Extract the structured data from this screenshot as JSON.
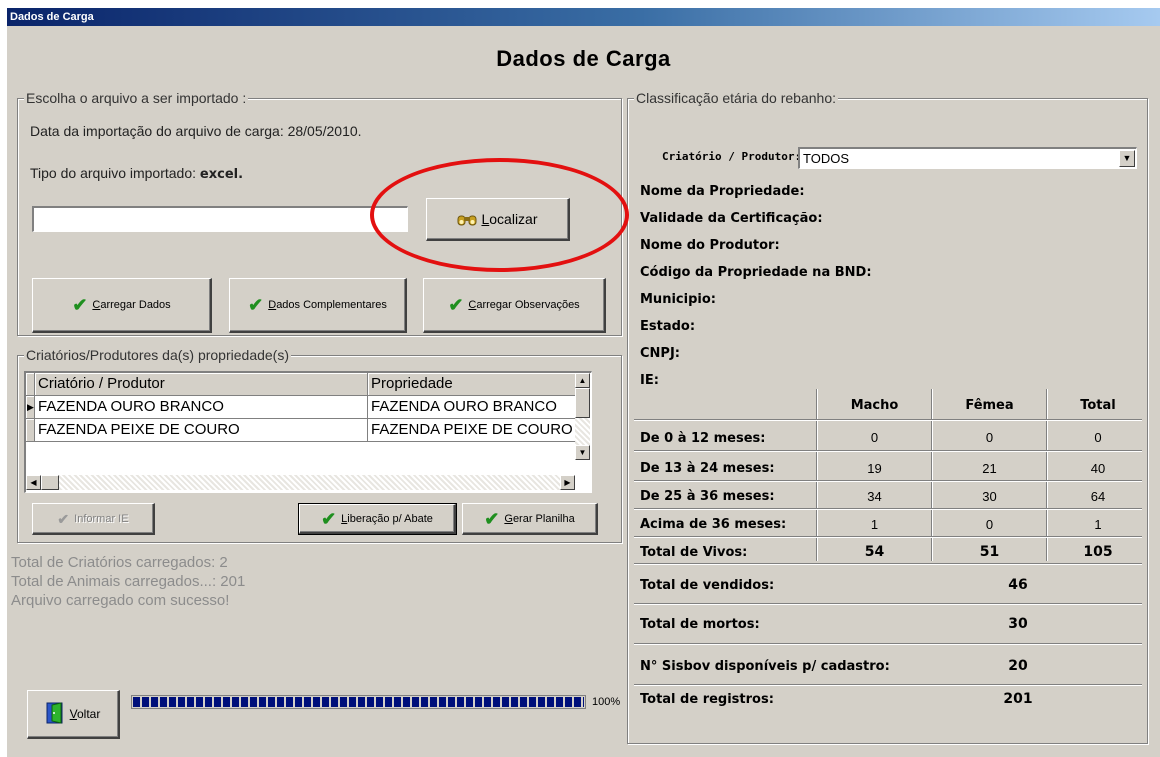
{
  "window": {
    "title": "Dados de Carga"
  },
  "heading": "Dados de Carga",
  "import_group": {
    "legend": "Escolha o arquivo a ser importado :",
    "date_line": "Data da importação do arquivo de carga: 28/05/2010.",
    "type_label": "Tipo do arquivo importado:",
    "type_value": "excel.",
    "file_path_value": "",
    "locate_button": {
      "label_u": "L",
      "label_rest": "ocalizar",
      "icon": "binoculars-icon"
    },
    "buttons": [
      {
        "label_u": "C",
        "label_rest": "arregar Dados",
        "icon": "check-icon"
      },
      {
        "label_u": "D",
        "label_rest": "ados Complementares",
        "icon": "check-icon"
      },
      {
        "label_u": "C",
        "label_rest": "arregar Observações",
        "icon": "check-icon"
      }
    ]
  },
  "producers_group": {
    "legend": "Criatórios/Produtores da(s) propriedade(s)",
    "columns": [
      "Criatório / Produtor",
      "Propriedade"
    ],
    "rows": [
      {
        "produtor": "FAZENDA OURO BRANCO",
        "propriedade": "FAZENDA OURO BRANCO",
        "current": true
      },
      {
        "produtor": "FAZENDA PEIXE DE COURO",
        "propriedade": "FAZENDA PEIXE DE COURO",
        "current": false
      }
    ],
    "buttons": {
      "informar_ie": "Informar IE",
      "liberacao": {
        "label_u": "L",
        "label_rest": "iberação p/ Abate"
      },
      "gerar": {
        "label_u": "G",
        "label_rest": "erar Planilha"
      }
    }
  },
  "status": {
    "line1": "Total de Criatórios carregados: 2",
    "line2": "Total de Animais carregados...: 201",
    "line3": "Arquivo carregado com sucesso!"
  },
  "footer": {
    "voltar": {
      "label_u": "V",
      "label_rest": "oltar",
      "icon": "exit-door-icon"
    },
    "progress_percent": 100,
    "progress_text": "100%"
  },
  "classification": {
    "legend": "Classificação etária do rebanho:",
    "producer_label": "Criatório / Produtor:",
    "producer_selected": "TODOS",
    "fields": [
      "Nome da Propriedade:",
      "Validade da Certificação:",
      "Nome do Produtor:",
      "Código da Propriedade na BND:",
      "Municipio:",
      "Estado:",
      "CNPJ:",
      "IE:"
    ],
    "table": {
      "headers": [
        "Macho",
        "Fêmea",
        "Total"
      ],
      "rows": [
        {
          "label": "De 0 à 12 meses:",
          "macho": "0",
          "femea": "0",
          "total": "0"
        },
        {
          "label": "De 13 à 24 meses:",
          "macho": "19",
          "femea": "21",
          "total": "40"
        },
        {
          "label": "De 25 à 36 meses:",
          "macho": "34",
          "femea": "30",
          "total": "64"
        },
        {
          "label": "Acima de 36 meses:",
          "macho": "1",
          "femea": "0",
          "total": "1"
        }
      ],
      "vivos": {
        "label": "Total de Vivos:",
        "macho": "54",
        "femea": "51",
        "total": "105"
      }
    },
    "summary": [
      {
        "label": "Total de vendidos:",
        "value": "46"
      },
      {
        "label": "Total de mortos:",
        "value": "30"
      },
      {
        "label": "N° Sisbov disponíveis p/ cadastro:",
        "value": "20"
      },
      {
        "label": "Total de registros:",
        "value": "201"
      }
    ]
  },
  "annotation": {
    "color": "#e31010"
  }
}
